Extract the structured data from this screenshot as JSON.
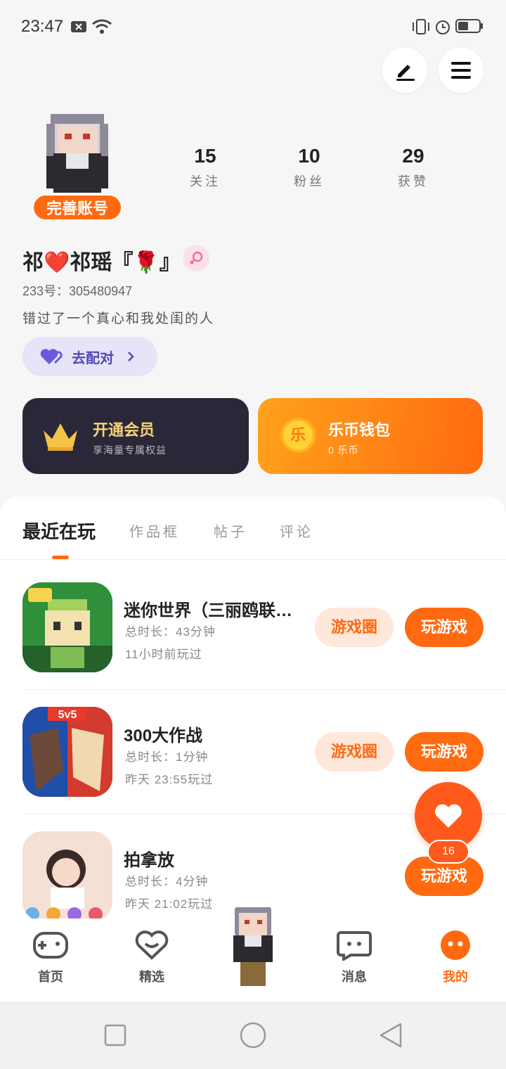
{
  "status_bar": {
    "time": "23:47"
  },
  "profile": {
    "complete_account": "完善账号",
    "stats": [
      {
        "value": "15",
        "label": "关注"
      },
      {
        "value": "10",
        "label": "粉丝"
      },
      {
        "value": "29",
        "label": "获赞"
      }
    ],
    "nickname": "祁❤️祁瑶『🌹』",
    "uid": "233号：305480947",
    "bio": "错过了一个真心和我处闺的人",
    "match_label": "去配对"
  },
  "cards": {
    "vip_title": "开通会员",
    "vip_sub": "享海量专属权益",
    "coin_title": "乐币钱包",
    "coin_sub": "0 乐币",
    "coin_glyph": "乐"
  },
  "tabs": [
    "最近在玩",
    "作品框",
    "帖子",
    "评论"
  ],
  "games": [
    {
      "name": "迷你世界（三丽鸥联…",
      "duration": "总时长：43分钟",
      "last_played": "11小时前玩过",
      "circle_label": "游戏圈",
      "play_label": "玩游戏"
    },
    {
      "name": "300大作战",
      "duration": "总时长：1分钟",
      "last_played": "昨天 23:55玩过",
      "circle_label": "游戏圈",
      "play_label": "玩游戏"
    },
    {
      "name": "拍拿放",
      "duration": "总时长：4分钟",
      "last_played": "昨天 21:02玩过",
      "play_label": "玩游戏"
    }
  ],
  "game_icon_text": {
    "g2_badge": "5v5"
  },
  "float_heart_count": "16",
  "bottom_nav": [
    {
      "label": "首页",
      "icon": "gamepad-icon"
    },
    {
      "label": "精选",
      "icon": "heart-chat-icon"
    },
    {
      "label": "",
      "icon": "avatar-center"
    },
    {
      "label": "消息",
      "icon": "message-icon"
    },
    {
      "label": "我的",
      "icon": "profile-face-icon"
    }
  ],
  "colors": {
    "accent": "#ff6a10",
    "vip_bg": "#2a2838",
    "match_bg": "#e6e4f6"
  }
}
